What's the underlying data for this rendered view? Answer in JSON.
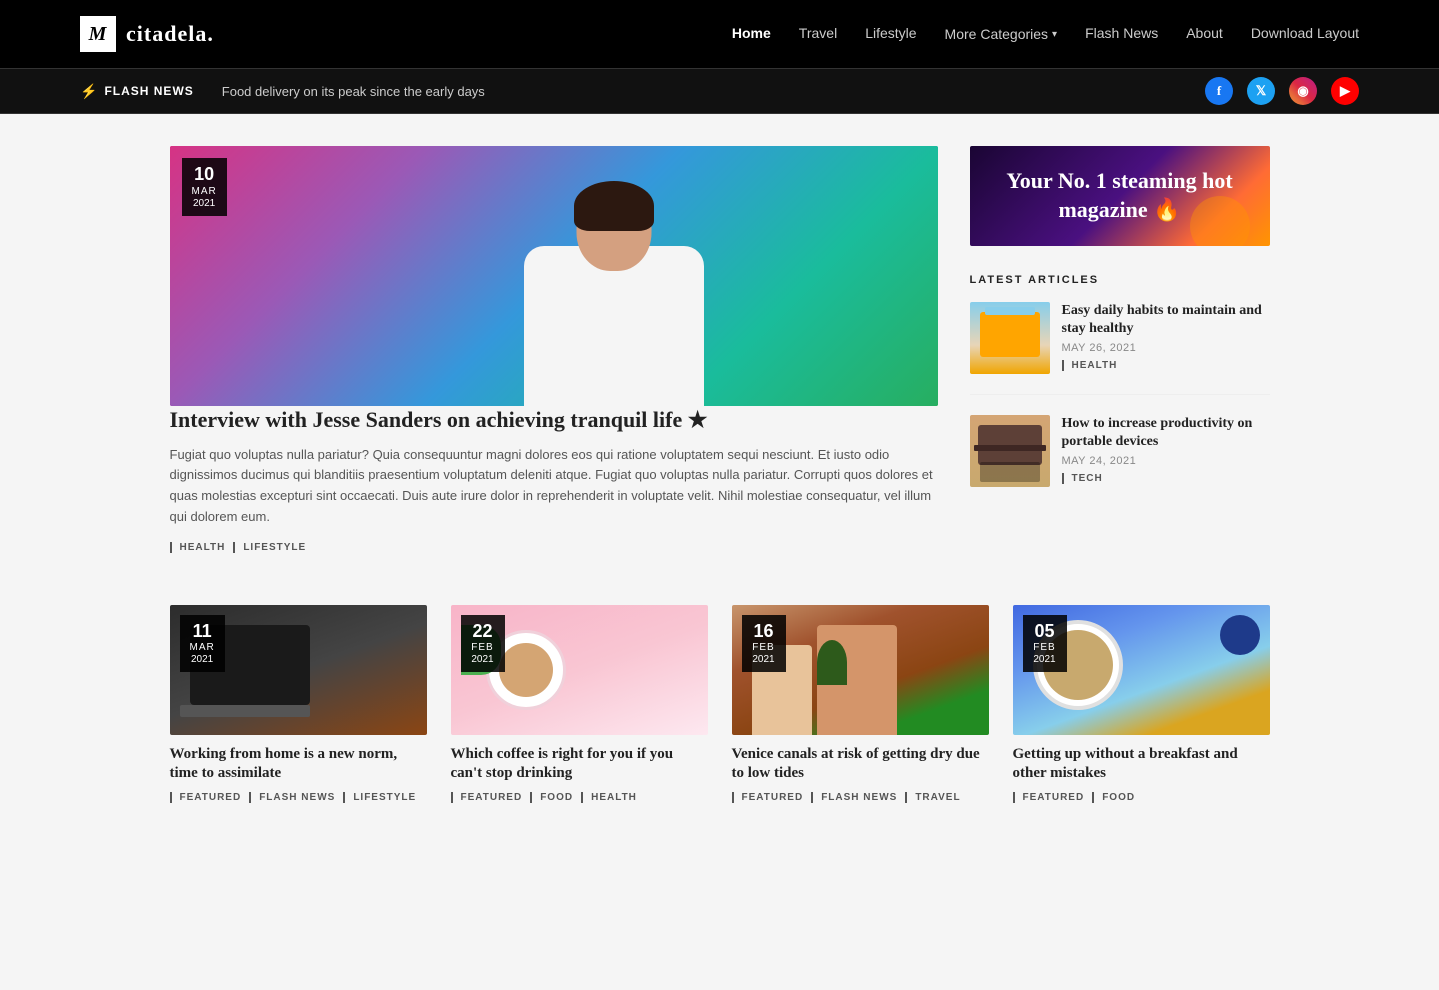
{
  "brand": {
    "logo_letter": "M",
    "site_name": "citadela."
  },
  "nav": {
    "links": [
      {
        "label": "Home",
        "active": true
      },
      {
        "label": "Travel",
        "active": false
      },
      {
        "label": "Lifestyle",
        "active": false
      },
      {
        "label": "More Categories",
        "active": false,
        "has_dropdown": true
      },
      {
        "label": "Flash News",
        "active": false
      },
      {
        "label": "About",
        "active": false
      },
      {
        "label": "Download Layout",
        "active": false
      }
    ]
  },
  "flash_news": {
    "label": "Flash News",
    "text": "Food delivery on its peak since the early days"
  },
  "social": {
    "facebook": "f",
    "twitter": "t",
    "instagram": "in",
    "youtube": "▶"
  },
  "hero": {
    "date_day": "10",
    "date_month": "MAR",
    "date_year": "2021",
    "title": "Interview with Jesse Sanders on achieving tranquil life ★",
    "excerpt": "Fugiat quo voluptas nulla pariatur? Quia consequuntur magni dolores eos qui ratione voluptatem sequi nesciunt. Et iusto odio dignissimos ducimus qui blanditiis praesentium voluptatum deleniti atque. Fugiat quo voluptas nulla pariatur. Corrupti quos dolores et quas molestias excepturi sint occaecati. Duis aute irure dolor in reprehenderit in voluptate velit. Nihil molestiae consequatur, vel illum qui dolorem eum.",
    "tags": [
      "Health",
      "Lifestyle"
    ]
  },
  "promo": {
    "text": "Your No. 1 steaming hot magazine 🔥"
  },
  "latest": {
    "label": "LATEST ARTICLES",
    "articles": [
      {
        "title": "Easy daily habits to maintain and stay healthy",
        "date": "MAY 26, 2021",
        "tag": "HEALTH"
      },
      {
        "title": "How to increase productivity on portable devices",
        "date": "MAY 24, 2021",
        "tag": "TECH"
      }
    ]
  },
  "grid": [
    {
      "day": "11",
      "month": "MAR",
      "year": "2021",
      "title": "Working from home is a new norm, time to assimilate",
      "tags": [
        "FEATURED",
        "FLASH NEWS",
        "LIFESTYLE"
      ],
      "img_type": "laptop"
    },
    {
      "day": "22",
      "month": "FEB",
      "year": "2021",
      "title": "Which coffee is right for you if you can't stop drinking",
      "tags": [
        "FEATURED",
        "FOOD",
        "HEALTH"
      ],
      "img_type": "coffee"
    },
    {
      "day": "16",
      "month": "FEB",
      "year": "2021",
      "title": "Venice canals at risk of getting dry due to low tides",
      "tags": [
        "FEATURED",
        "FLASH NEWS",
        "TRAVEL"
      ],
      "img_type": "venice"
    },
    {
      "day": "05",
      "month": "FEB",
      "year": "2021",
      "title": "Getting up without a breakfast and other mistakes",
      "tags": [
        "FEATURED",
        "FOOD"
      ],
      "img_type": "breakfast"
    }
  ]
}
